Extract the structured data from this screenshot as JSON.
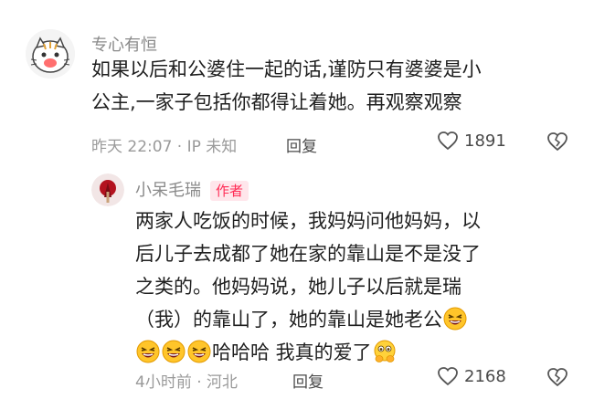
{
  "comment": {
    "username": "专心有恒",
    "lines": [
      "如果以后和公婆住一起的话,谨防只有婆婆是小",
      "公主,一家子包括你都得让着她。再观察观察"
    ],
    "meta": "昨天 22:07 · IP 未知",
    "reply_label": "回复",
    "likes": "1891"
  },
  "reply": {
    "username": "小呆毛瑞",
    "badge": "作者",
    "lines": [
      "两家人吃饭的时候，我妈妈问他妈妈，以",
      "后儿子去成都了她在家的靠山是不是没了",
      "之类的。他妈妈说，她儿子以后就是瑞",
      "（我）的靠山了，她的靠山是她老公"
    ],
    "last_line_text": "哈哈哈 我真的爱了",
    "meta": "4小时前 · 河北",
    "reply_label": "回复",
    "likes": "2168"
  },
  "icons": {
    "like": "heart-outline-icon",
    "dislike": "broken-heart-icon",
    "emoji_laugh": "laughing-emoji-icon",
    "emoji_touched": "touched-emoji-icon"
  },
  "colors": {
    "badge_text": "#ff2c55",
    "badge_bg": "#ffe6eb",
    "meta": "#9a9a9a"
  }
}
